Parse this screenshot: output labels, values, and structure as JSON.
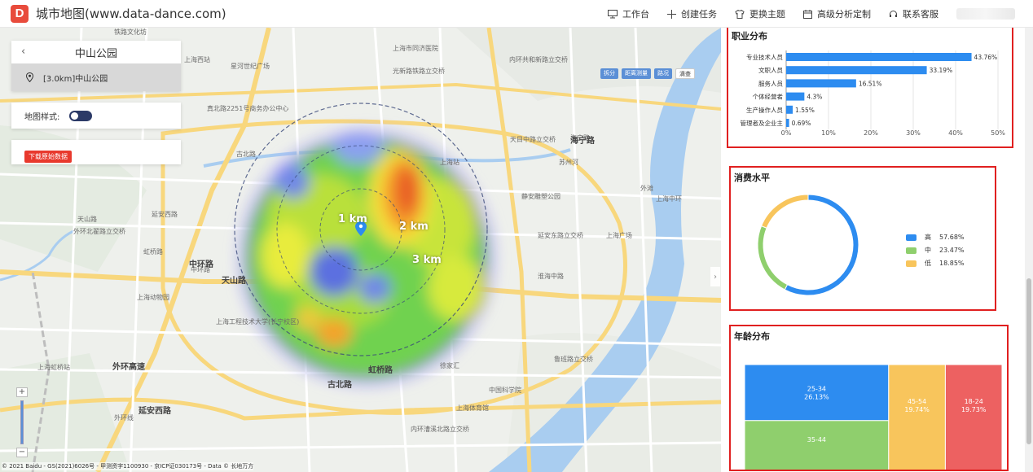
{
  "header": {
    "logo_letter": "D",
    "title": "城市地图(www.data-dance.com)",
    "nav": [
      {
        "label": "工作台",
        "icon": "monitor-icon"
      },
      {
        "label": "创建任务",
        "icon": "plus-icon"
      },
      {
        "label": "更换主题",
        "icon": "shirt-icon"
      },
      {
        "label": "高级分析定制",
        "icon": "calendar-icon"
      },
      {
        "label": "联系客服",
        "icon": "headset-icon"
      }
    ]
  },
  "search_panel": {
    "title": "中山公园",
    "back_icon": "chevron-left-icon",
    "result_label": "[3.0km]中山公园",
    "result_icon": "map-pin-icon"
  },
  "style_panel": {
    "label": "地图样式:",
    "toggle_on": true
  },
  "download_panel": {
    "button_label": "下载原始数据"
  },
  "map": {
    "tools": [
      "拆分",
      "距离测量",
      "路况",
      "滴查"
    ],
    "rings": [
      "1 km",
      "2 km",
      "3 km"
    ],
    "copyright": "© 2021 Baidu - GS(2021)6026号 - 甲测资字1100930 - 京ICP证030173号 - Data © 长地万方",
    "labels": [
      {
        "t": "铁路文化坊"
      },
      {
        "t": "上海市同济医院"
      },
      {
        "t": "内环共和新路立交桥"
      },
      {
        "t": "光新路铁路立交桥"
      },
      {
        "t": "上海西站"
      },
      {
        "t": "星河世纪广场"
      },
      {
        "t": "真北路2251号商务办公中心"
      },
      {
        "t": "古北路"
      },
      {
        "t": "天目中路立交桥"
      },
      {
        "t": "海宁路"
      },
      {
        "t": "静安雕塑公园"
      },
      {
        "t": "上海站"
      },
      {
        "t": "上海中环"
      },
      {
        "t": "外环北翟路立交桥"
      },
      {
        "t": "苏州河"
      },
      {
        "t": "延安东路立交桥"
      },
      {
        "t": "上海广场"
      },
      {
        "t": "外滩"
      },
      {
        "t": "上海虹桥站"
      },
      {
        "t": "虹桥路"
      },
      {
        "t": "上海工程技术大学(长宁校区)"
      },
      {
        "t": "鲁班路立交桥"
      },
      {
        "t": "中国科学院"
      },
      {
        "t": "上海动物园"
      },
      {
        "t": "延安西路"
      },
      {
        "t": "天山路"
      },
      {
        "t": "中环路"
      },
      {
        "t": "上海体育馆"
      },
      {
        "t": "外环线"
      },
      {
        "t": "内环漕溪北路立交桥"
      },
      {
        "t": "徐家汇"
      },
      {
        "t": "淮海中路"
      }
    ],
    "roads": [
      {
        "t": "中环路"
      },
      {
        "t": "天山路"
      },
      {
        "t": "古北路"
      },
      {
        "t": "虹桥路"
      },
      {
        "t": "延安西路"
      },
      {
        "t": "外环高速"
      },
      {
        "t": "海宁路"
      }
    ]
  },
  "right_panel": {
    "occupation": {
      "title": "职业分布"
    },
    "consumption": {
      "title": "消费水平"
    },
    "age": {
      "title": "年龄分布"
    }
  },
  "chart_data": [
    {
      "type": "bar",
      "title": "职业分布",
      "orientation": "horizontal",
      "categories": [
        "专业技术人员",
        "文职人员",
        "服务人员",
        "个体经营者",
        "生产操作人员",
        "管理者及企业主"
      ],
      "values": [
        43.76,
        33.19,
        16.51,
        4.3,
        1.55,
        0.69
      ],
      "value_labels": [
        "43.76%",
        "33.19%",
        "16.51%",
        "4.3%",
        "1.55%",
        "0.69%"
      ],
      "xlim": [
        0,
        50
      ],
      "xticks": [
        "0%",
        "10%",
        "20%",
        "30%",
        "40%",
        "50%"
      ],
      "grid": true,
      "color": "#2d8cf0"
    },
    {
      "type": "pie",
      "title": "消费水平",
      "donut": true,
      "categories": [
        "高",
        "中",
        "低"
      ],
      "values": [
        57.68,
        23.47,
        18.85
      ],
      "value_labels": [
        "57.68%",
        "23.47%",
        "18.85%"
      ],
      "colors": [
        "#2d8cf0",
        "#8fcf6d",
        "#f8c55c"
      ],
      "legend": "right"
    },
    {
      "type": "treemap",
      "title": "年龄分布",
      "categories": [
        "25-34",
        "35-44",
        "45-54",
        "18-24"
      ],
      "values": [
        26.13,
        24.0,
        19.74,
        19.73
      ],
      "value_labels": [
        "26.13%",
        "",
        "19.74%",
        "19.73%"
      ],
      "colors": [
        "#2d8cf0",
        "#8fcf6d",
        "#f8c55c",
        "#ed6161"
      ]
    }
  ]
}
